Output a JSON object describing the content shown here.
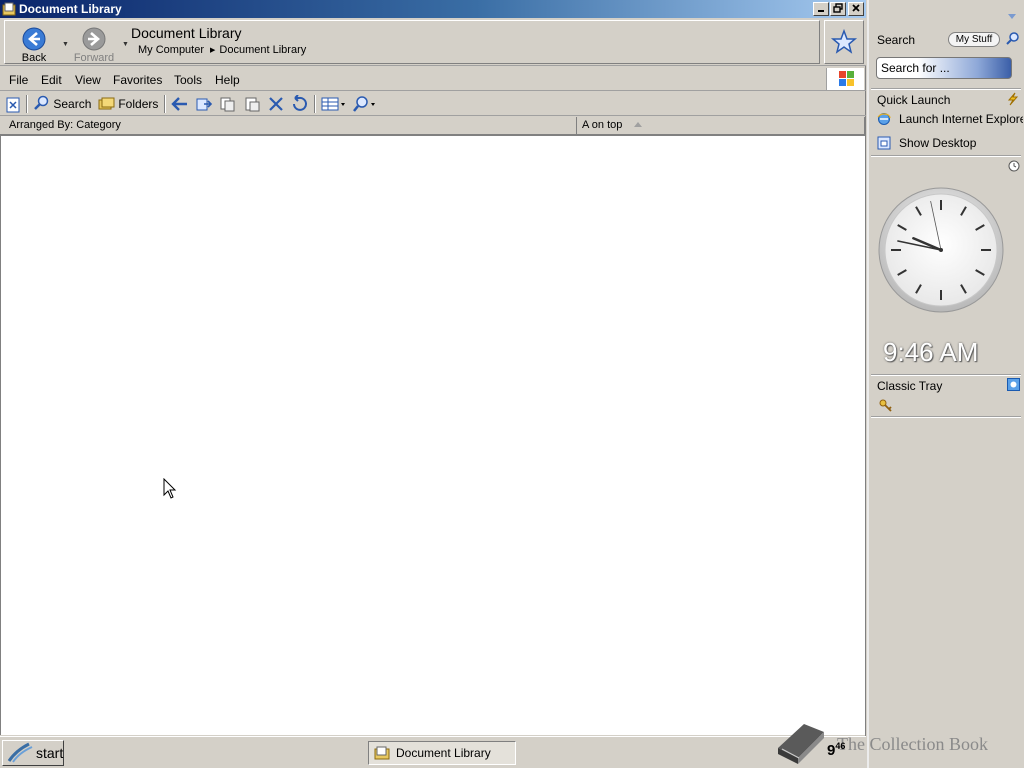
{
  "window": {
    "title": "Document Library"
  },
  "nav": {
    "back_label": "Back",
    "forward_label": "Forward",
    "address_title": "Document Library",
    "breadcrumb": [
      "My Computer",
      "Document Library"
    ]
  },
  "menubar": {
    "items": [
      "File",
      "Edit",
      "View",
      "Favorites",
      "Tools",
      "Help"
    ]
  },
  "toolbar": {
    "search_label": "Search",
    "folders_label": "Folders"
  },
  "columns": {
    "arranged_by": "Arranged By: Category",
    "sort": "A on top"
  },
  "taskbar": {
    "start_label": "start",
    "task_item": "Document Library"
  },
  "sidebar": {
    "search_header": "Search",
    "my_stuff": "My Stuff",
    "search_placeholder": "Search for ...",
    "quick_launch_header": "Quick Launch",
    "quick_launch_items": [
      "Launch Internet Explorer",
      "Show Desktop"
    ],
    "digital_time": "9:46 AM",
    "classic_tray_header": "Classic Tray"
  },
  "tray": {
    "time_hour": "9",
    "time_min": "46",
    "time_ampm": "AM"
  },
  "watermark": {
    "text": "The Collection Book"
  },
  "clock": {
    "hour": 9,
    "minute": 46,
    "second": 58
  },
  "colors": {
    "title_start": "#0a246a",
    "title_end": "#a6caf0",
    "face": "#d4d0c8",
    "content_bg": "#ffffff"
  }
}
